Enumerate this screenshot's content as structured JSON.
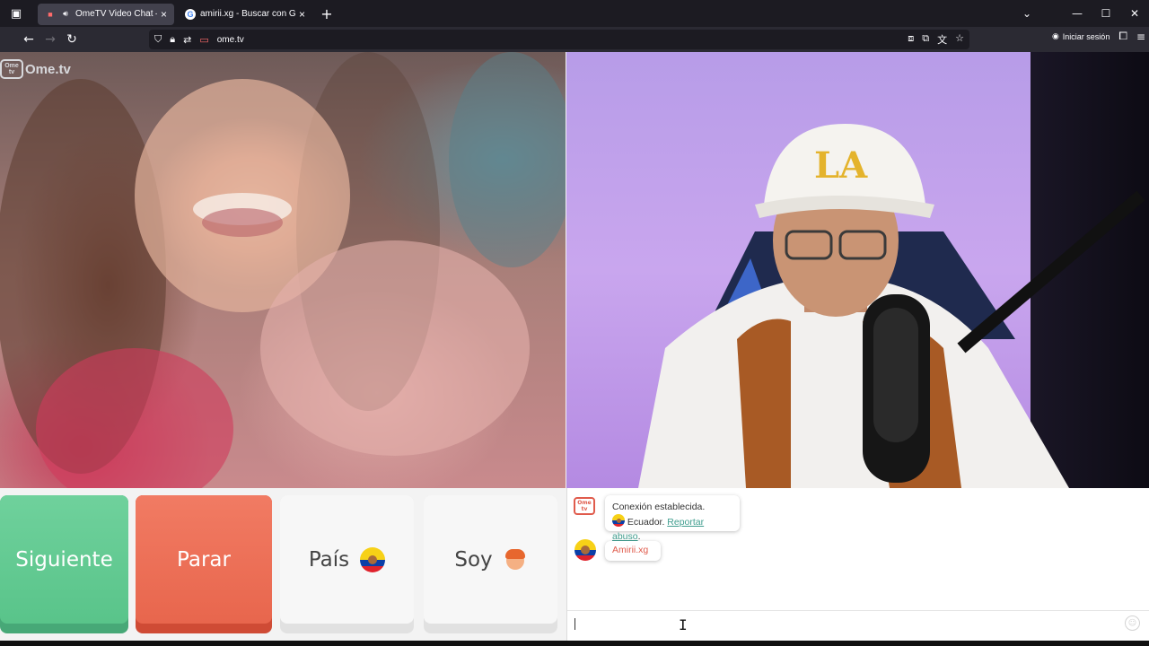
{
  "browser": {
    "tabs": [
      {
        "title": "OmeTV Video Chat — OmeTV",
        "active": true
      },
      {
        "title": "amirii.xg - Buscar con Google",
        "active": false
      }
    ],
    "url": "ome.tv",
    "signin_label": "Iniciar sesión"
  },
  "site": {
    "logo_badge": "Ome tv",
    "logo_text": "Ome.tv"
  },
  "controls": {
    "next_label": "Siguiente",
    "stop_label": "Parar",
    "country_label": "País",
    "gender_label": "Soy"
  },
  "chat": {
    "system_icon": "Ome tv",
    "system_line1": "Conexión establecida.",
    "country": "Ecuador.",
    "report_link": "Reportar abuso",
    "peer_name": "Amirii.xg",
    "input_placeholder": ""
  },
  "colors": {
    "next": "#59c48a",
    "stop": "#e8664d",
    "accent_red": "#e05b4c",
    "link": "#3f9d8e"
  },
  "icons": [
    "tab-list-icon",
    "audio-icon",
    "google-icon",
    "close-icon",
    "plus-icon",
    "chevron-down-icon",
    "minimize-icon",
    "maximize-icon",
    "back-icon",
    "forward-icon",
    "reload-icon",
    "shield-icon",
    "lock-icon",
    "permissions-icon",
    "bookmark-star-icon",
    "account-icon",
    "extensions-icon",
    "menu-icon",
    "ecuador-flag-icon",
    "boy-icon",
    "emoji-icon"
  ]
}
